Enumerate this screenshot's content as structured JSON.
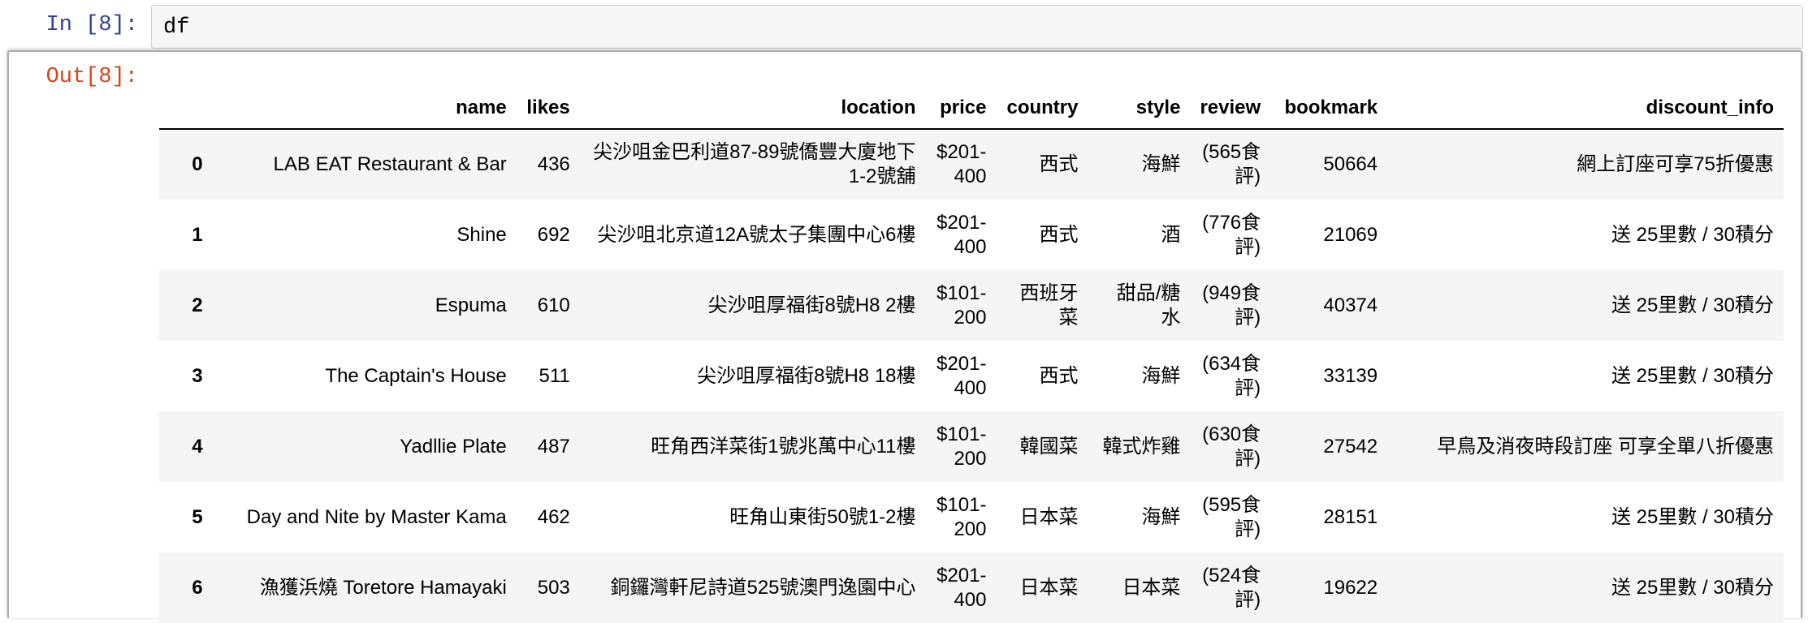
{
  "notebook": {
    "in_prompt": "In [8]:",
    "out_prompt": "Out[8]:",
    "input_code": "df"
  },
  "dataframe": {
    "columns": [
      "",
      "name",
      "likes",
      "location",
      "price",
      "country",
      "style",
      "review",
      "bookmark",
      "discount_info"
    ],
    "rows": [
      {
        "index": "0",
        "name": "LAB EAT Restaurant & Bar",
        "likes": "436",
        "location": "尖沙咀金巴利道87-89號僑豐大廈地下1-2號舖",
        "price": "$201-400",
        "country": "西式",
        "style": "海鮮",
        "review": "(565食評)",
        "bookmark": "50664",
        "discount_info": "網上訂座可享75折優惠"
      },
      {
        "index": "1",
        "name": "Shine",
        "likes": "692",
        "location": "尖沙咀北京道12A號太子集團中心6樓",
        "price": "$201-400",
        "country": "西式",
        "style": "酒",
        "review": "(776食評)",
        "bookmark": "21069",
        "discount_info": "送 25里數 / 30積分"
      },
      {
        "index": "2",
        "name": "Espuma",
        "likes": "610",
        "location": "尖沙咀厚福街8號H8 2樓",
        "price": "$101-200",
        "country": "西班牙菜",
        "style": "甜品/糖水",
        "review": "(949食評)",
        "bookmark": "40374",
        "discount_info": "送 25里數 / 30積分"
      },
      {
        "index": "3",
        "name": "The Captain's House",
        "likes": "511",
        "location": "尖沙咀厚福街8號H8 18樓",
        "price": "$201-400",
        "country": "西式",
        "style": "海鮮",
        "review": "(634食評)",
        "bookmark": "33139",
        "discount_info": "送 25里數 / 30積分"
      },
      {
        "index": "4",
        "name": "Yadllie Plate",
        "likes": "487",
        "location": "旺角西洋菜街1號兆萬中心11樓",
        "price": "$101-200",
        "country": "韓國菜",
        "style": "韓式炸雞",
        "review": "(630食評)",
        "bookmark": "27542",
        "discount_info": "早鳥及消夜時段訂座 可享全單八折優惠"
      },
      {
        "index": "5",
        "name": "Day and Nite by Master Kama",
        "likes": "462",
        "location": "旺角山東街50號1-2樓",
        "price": "$101-200",
        "country": "日本菜",
        "style": "海鮮",
        "review": "(595食評)",
        "bookmark": "28151",
        "discount_info": "送 25里數 / 30積分"
      },
      {
        "index": "6",
        "name": "漁獲浜燒 Toretore Hamayaki",
        "likes": "503",
        "location": "銅鑼灣軒尼詩道525號澳門逸園中心",
        "price": "$201-400",
        "country": "日本菜",
        "style": "日本菜",
        "review": "(524食評)",
        "bookmark": "19622",
        "discount_info": "送 25里數 / 30積分"
      }
    ]
  }
}
